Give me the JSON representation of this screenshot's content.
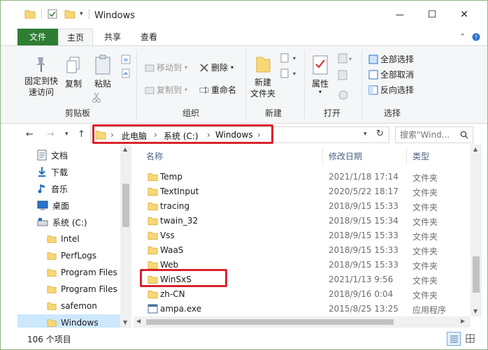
{
  "window": {
    "title": "Windows",
    "minimize_glyph": "—",
    "maximize_glyph": "☐",
    "close_glyph": "✕"
  },
  "tabs": {
    "file": "文件",
    "home": "主页",
    "share": "共享",
    "view": "查看"
  },
  "ribbon": {
    "clipboard": {
      "pin": "固定到快速访问",
      "pin_line1": "固定到快",
      "pin_line2": "速访问",
      "copy": "复制",
      "paste": "粘贴",
      "label": "剪贴板"
    },
    "organize": {
      "move_to": "移动到",
      "copy_to": "复制到",
      "delete": "删除",
      "rename": "重命名",
      "label": "组织"
    },
    "new": {
      "new_folder_line1": "新建",
      "new_folder_line2": "文件夹",
      "label": "新建"
    },
    "open": {
      "properties": "属性",
      "label": "打开"
    },
    "select": {
      "select_all": "全部选择",
      "select_none": "全部取消",
      "invert": "反向选择",
      "label": "选择"
    }
  },
  "address": {
    "crumbs": [
      "此电脑",
      "系统 (C:)",
      "Windows"
    ],
    "search_placeholder": "搜索\"Wind..."
  },
  "nav_pane": {
    "items": [
      {
        "label": "文档",
        "icon": "documents-icon"
      },
      {
        "label": "下载",
        "icon": "download-icon"
      },
      {
        "label": "音乐",
        "icon": "music-icon"
      },
      {
        "label": "桌面",
        "icon": "desktop-icon"
      },
      {
        "label": "系统 (C:)",
        "icon": "drive-icon"
      },
      {
        "label": "Intel",
        "icon": "folder-icon"
      },
      {
        "label": "PerfLogs",
        "icon": "folder-icon"
      },
      {
        "label": "Program Files",
        "icon": "folder-icon"
      },
      {
        "label": "Program Files",
        "icon": "folder-icon"
      },
      {
        "label": "safemon",
        "icon": "folder-icon"
      },
      {
        "label": "Windows",
        "icon": "folder-icon"
      }
    ]
  },
  "columns": {
    "name": "名称",
    "date": "修改日期",
    "type": "类型"
  },
  "files": [
    {
      "name": "Temp",
      "date": "2021/1/18 17:14",
      "type": "文件夹"
    },
    {
      "name": "TextInput",
      "date": "2020/5/22 18:17",
      "type": "文件夹"
    },
    {
      "name": "tracing",
      "date": "2018/9/15 15:33",
      "type": "文件夹"
    },
    {
      "name": "twain_32",
      "date": "2018/9/15 15:34",
      "type": "文件夹"
    },
    {
      "name": "Vss",
      "date": "2018/9/15 15:33",
      "type": "文件夹"
    },
    {
      "name": "WaaS",
      "date": "2018/9/15 15:33",
      "type": "文件夹"
    },
    {
      "name": "Web",
      "date": "2018/9/15 15:33",
      "type": "文件夹"
    },
    {
      "name": "WinSxS",
      "date": "2021/1/13 9:56",
      "type": "文件夹"
    },
    {
      "name": "zh-CN",
      "date": "2018/9/16 0:04",
      "type": "文件夹"
    },
    {
      "name": "ampa.exe",
      "date": "2015/8/25 13:25",
      "type": "应用程序"
    }
  ],
  "status": {
    "item_count": "106 个项目"
  },
  "colors": {
    "accent_green": "#2f7d32",
    "highlight_red": "#d9232d",
    "folder_yellow": "#f8d775",
    "selection_blue": "#cce8ff"
  }
}
